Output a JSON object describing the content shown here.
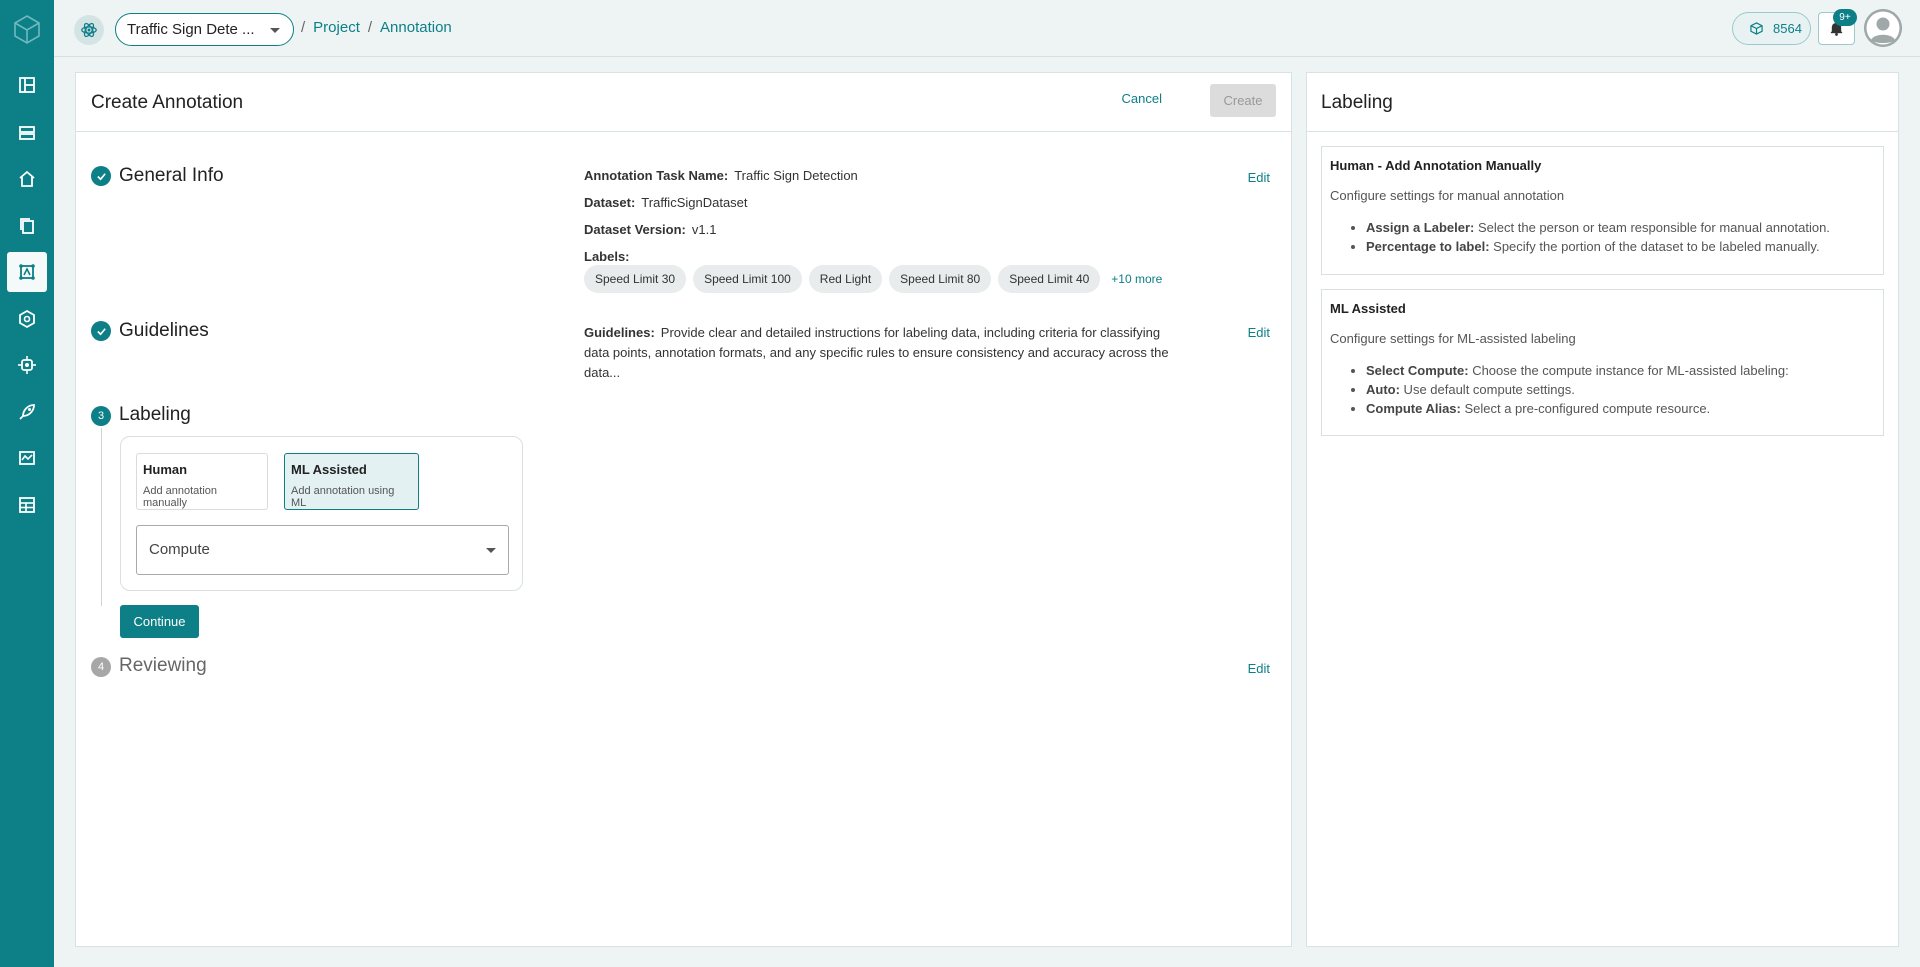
{
  "header": {
    "project_name": "Traffic Sign Dete ...",
    "breadcrumb": [
      "Project",
      "Annotation"
    ],
    "credits": "8564",
    "notifications": "9+"
  },
  "main": {
    "title": "Create Annotation",
    "cancel_label": "Cancel",
    "create_label": "Create",
    "edit_label": "Edit",
    "steps": {
      "general": {
        "title": "General Info",
        "task_name_label": "Annotation Task Name:",
        "task_name": "Traffic Sign Detection",
        "dataset_label": "Dataset:",
        "dataset": "TrafficSignDataset",
        "version_label": "Dataset Version:",
        "version": "v1.1",
        "labels_label": "Labels:",
        "labels": [
          "Speed Limit 30",
          "Speed Limit 100",
          "Red Light",
          "Speed Limit 80",
          "Speed Limit 40"
        ],
        "more": "+10 more"
      },
      "guidelines": {
        "title": "Guidelines",
        "label": "Guidelines:",
        "text": "Provide clear and detailed instructions for labeling data, including criteria for classifying data points, annotation formats, and any specific rules to ensure consistency and accuracy across the data..."
      },
      "labeling": {
        "number": "3",
        "title": "Labeling",
        "options": [
          {
            "title": "Human",
            "subtitle": "Add annotation manually"
          },
          {
            "title": "ML Assisted",
            "subtitle": "Add annotation using ML"
          }
        ],
        "compute_placeholder": "Compute",
        "continue_label": "Continue"
      },
      "reviewing": {
        "number": "4",
        "title": "Reviewing"
      }
    }
  },
  "side": {
    "title": "Labeling",
    "human": {
      "title": "Human - Add Annotation Manually",
      "desc": "Configure settings for manual annotation",
      "items": [
        {
          "k": "Assign a Labeler:",
          "v": " Select the person or team responsible for manual annotation."
        },
        {
          "k": "Percentage to label:",
          "v": " Specify the portion of the dataset to be labeled manually."
        }
      ]
    },
    "ml": {
      "title": "ML Assisted",
      "desc": "Configure settings for ML-assisted labeling",
      "items": [
        {
          "k": "Select Compute:",
          "v": " Choose the compute instance for ML-assisted labeling:"
        },
        {
          "k": "Auto:",
          "v": " Use default compute settings."
        },
        {
          "k": "Compute Alias:",
          "v": " Select a pre-configured compute resource."
        }
      ]
    }
  }
}
